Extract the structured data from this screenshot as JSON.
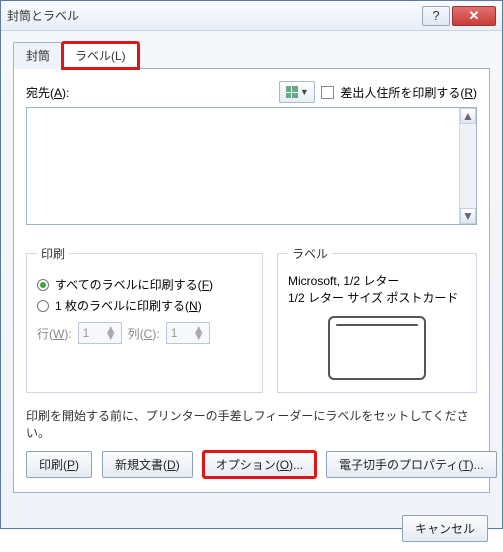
{
  "title": "封筒とラベル",
  "tabs": {
    "envelope": "封筒",
    "label": "ラベル(L)"
  },
  "addr": {
    "label_pre": "宛先(",
    "label_acc": "A",
    "label_post": "):",
    "sender_pre": "差出人住所を印刷する(",
    "sender_acc": "R",
    "sender_post": ")"
  },
  "print": {
    "legend": "印刷",
    "all_pre": "すべてのラベルに印刷する(",
    "all_acc": "F",
    "all_post": ")",
    "one_pre": "1 枚のラベルに印刷する(",
    "one_acc": "N",
    "one_post": ")",
    "row_pre": "行(",
    "row_acc": "W",
    "row_post": "):",
    "col_pre": "列(",
    "col_acc": "C",
    "col_post": "):",
    "row_val": "1",
    "col_val": "1"
  },
  "label": {
    "legend": "ラベル",
    "line1": "Microsoft, 1/2 レター",
    "line2": "1/2 レター サイズ ポストカード"
  },
  "hint": "印刷を開始する前に、プリンターの手差しフィーダーにラベルをセットしてください。",
  "buttons": {
    "print_pre": "印刷(",
    "print_acc": "P",
    "print_post": ")",
    "newdoc_pre": "新規文書(",
    "newdoc_acc": "D",
    "newdoc_post": ")",
    "options_pre": "オプション(",
    "options_acc": "O",
    "options_post": ")...",
    "estamp_pre": "電子切手のプロパティ(",
    "estamp_acc": "T",
    "estamp_post": ")...",
    "cancel": "キャンセル"
  }
}
